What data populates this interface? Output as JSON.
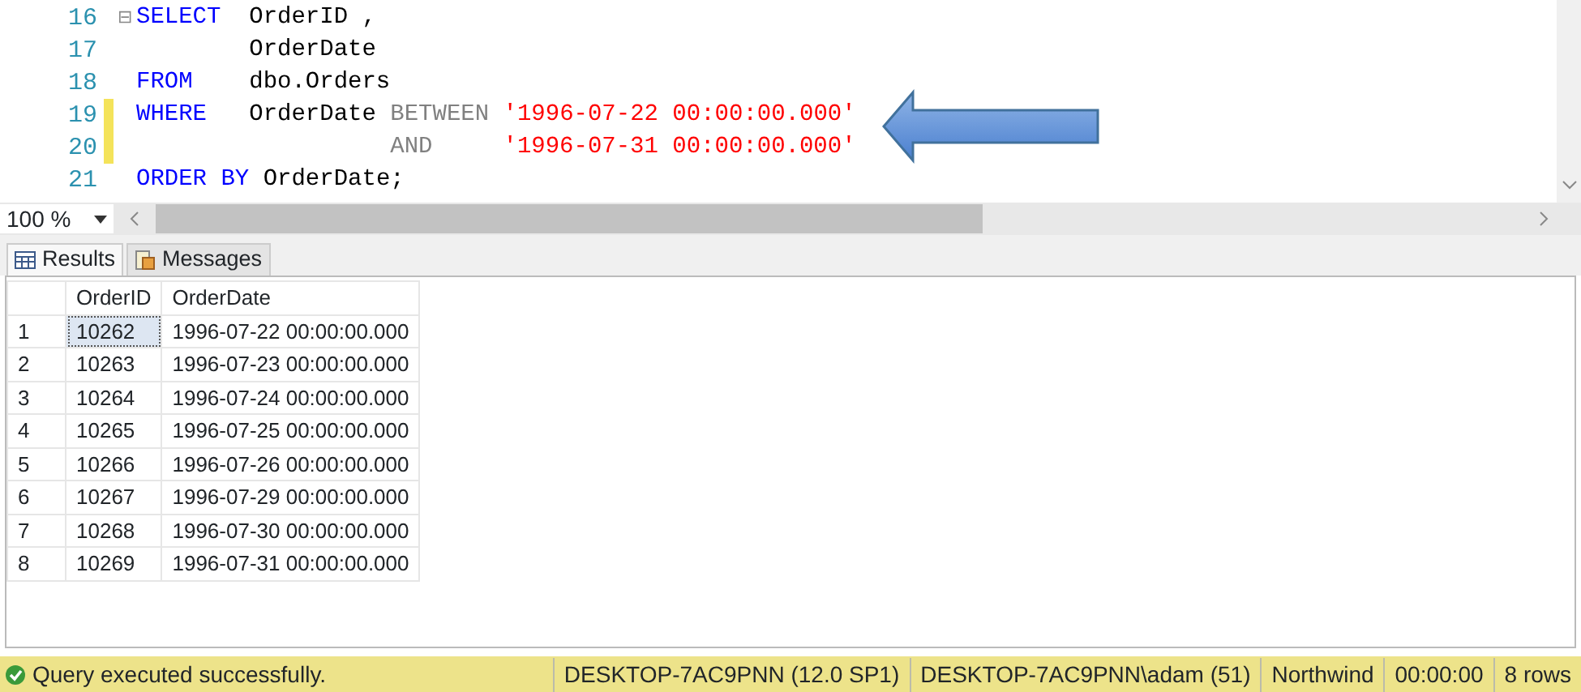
{
  "editor": {
    "lines": [
      {
        "number": "16",
        "collapse": "⊟",
        "changed": false,
        "tokens": [
          {
            "text": "SELECT",
            "kind": "keyword"
          },
          {
            "text": "  OrderID ,",
            "kind": "plain"
          }
        ]
      },
      {
        "number": "17",
        "changed": false,
        "tokens": [
          {
            "text": "        OrderDate",
            "kind": "plain"
          }
        ]
      },
      {
        "number": "18",
        "changed": false,
        "tokens": [
          {
            "text": "FROM",
            "kind": "keyword"
          },
          {
            "text": "    dbo.Orders",
            "kind": "plain"
          }
        ]
      },
      {
        "number": "19",
        "changed": true,
        "tokens": [
          {
            "text": "WHERE",
            "kind": "keyword"
          },
          {
            "text": "   OrderDate",
            "kind": "plain"
          },
          {
            "text": " BETWEEN",
            "kind": "operator"
          },
          {
            "text": " '1996-07-22 00:00:00.000'",
            "kind": "string"
          }
        ]
      },
      {
        "number": "20",
        "changed": true,
        "tokens": [
          {
            "text": "                  AND",
            "kind": "operator"
          },
          {
            "text": "     '1996-07-31 00:00:00.000'",
            "kind": "string"
          }
        ]
      },
      {
        "number": "21",
        "changed": false,
        "tokens": [
          {
            "text": "ORDER BY",
            "kind": "keyword"
          },
          {
            "text": " OrderDate;",
            "kind": "plain"
          }
        ]
      }
    ]
  },
  "zoom": {
    "value": "100 %"
  },
  "tabs": [
    {
      "label": "Results",
      "selected": true
    },
    {
      "label": "Messages",
      "selected": false
    }
  ],
  "grid": {
    "columns": [
      "OrderID",
      "OrderDate"
    ],
    "rows": [
      {
        "number": "1",
        "cells": [
          "10262",
          "1996-07-22 00:00:00.000"
        ],
        "selected": true
      },
      {
        "number": "2",
        "cells": [
          "10263",
          "1996-07-23 00:00:00.000"
        ],
        "selected": false
      },
      {
        "number": "3",
        "cells": [
          "10264",
          "1996-07-24 00:00:00.000"
        ],
        "selected": false
      },
      {
        "number": "4",
        "cells": [
          "10265",
          "1996-07-25 00:00:00.000"
        ],
        "selected": false
      },
      {
        "number": "5",
        "cells": [
          "10266",
          "1996-07-26 00:00:00.000"
        ],
        "selected": false
      },
      {
        "number": "6",
        "cells": [
          "10267",
          "1996-07-29 00:00:00.000"
        ],
        "selected": false
      },
      {
        "number": "7",
        "cells": [
          "10268",
          "1996-07-30 00:00:00.000"
        ],
        "selected": false
      },
      {
        "number": "8",
        "cells": [
          "10269",
          "1996-07-31 00:00:00.000"
        ],
        "selected": false
      }
    ]
  },
  "status_bar": {
    "message": "Query executed successfully.",
    "fields": [
      "DESKTOP-7AC9PNN (12.0 SP1)",
      "DESKTOP-7AC9PNN\\adam (51)",
      "Northwind",
      "00:00:00",
      "8 rows"
    ]
  }
}
